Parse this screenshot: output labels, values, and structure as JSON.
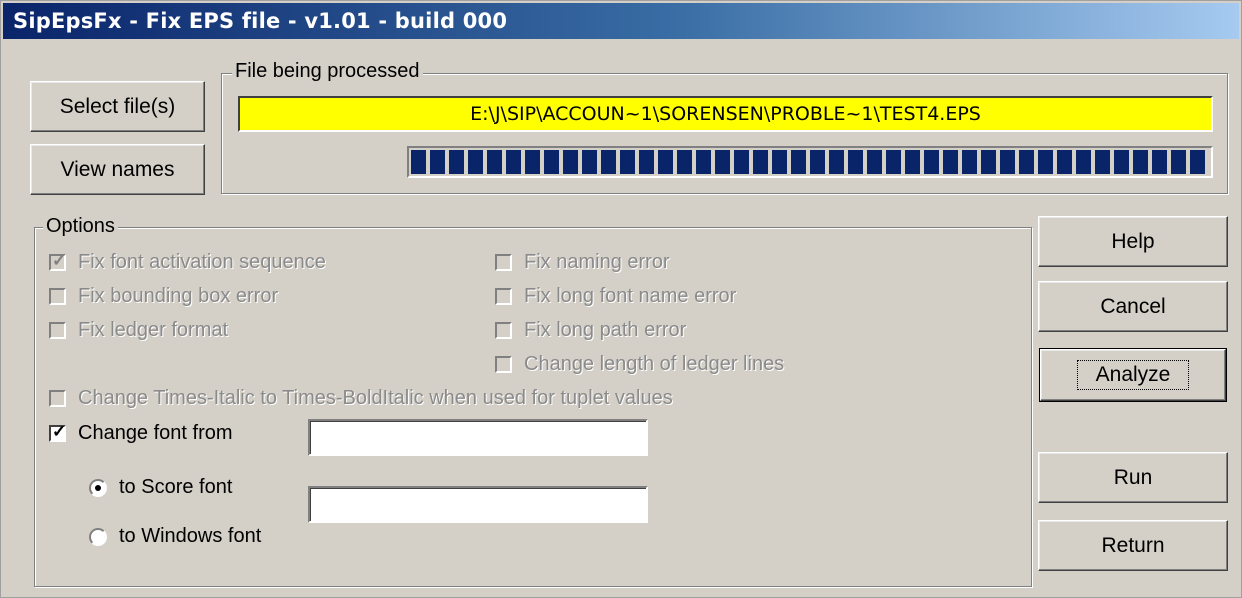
{
  "title": "SipEpsFx - Fix EPS file - v1.01 - build 000",
  "buttons": {
    "select_files": "Select file(s)",
    "view_names": "View names",
    "help": "Help",
    "cancel": "Cancel",
    "analyze": "Analyze",
    "run": "Run",
    "return": "Return"
  },
  "file_group": {
    "label": "File being processed",
    "path": "E:\\J\\SIP\\ACCOUN~1\\SORENSEN\\PROBLE~1\\TEST4.EPS",
    "progress": 1.0
  },
  "options": {
    "label": "Options",
    "fix_font_activation": "Fix font activation sequence",
    "fix_bounding_box": "Fix bounding box error",
    "fix_ledger_format": "Fix ledger format",
    "fix_naming": "Fix naming error",
    "fix_long_font_name": "Fix long font name error",
    "fix_long_path": "Fix long path error",
    "change_ledger_length": "Change length of ledger lines",
    "change_times_italic": "Change Times-Italic to Times-BoldItalic when used for tuplet values",
    "change_font_from": "Change font from",
    "from_value": "",
    "to_score_font": "to Score font",
    "to_windows_font": "to Windows font",
    "to_value": ""
  },
  "colors": {
    "path_bg": "#ffff00",
    "progress": "#0a246a",
    "face": "#d4d0c8"
  }
}
